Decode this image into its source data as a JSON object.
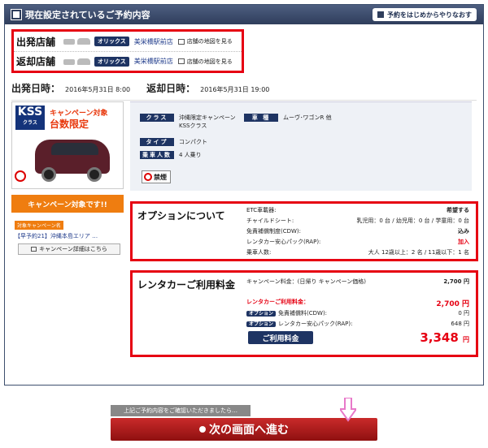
{
  "header": {
    "title": "現在設定されているご予約内容",
    "restart": "予約をはじめからやりなおす"
  },
  "stores": [
    {
      "label": "出発店舗",
      "brand": "オリックス",
      "name": "美栄橋駅前店",
      "map": "店舗の地図を見る"
    },
    {
      "label": "返却店舗",
      "brand": "オリックス",
      "name": "美栄橋駅前店",
      "map": "店舗の地図を見る"
    }
  ],
  "dates": {
    "depart_label": "出発日時：",
    "depart": "2016年5月31日 8:00",
    "return_label": "返却日時：",
    "return": "2016年5月31日 19:00"
  },
  "car": {
    "class_badge_top": "KSS",
    "class_badge_bottom": "クラス",
    "campaign_line1": "キャンペーン対象",
    "campaign_line2": "台数限定",
    "campaign_button": "キャンペーン対象です!!",
    "campaign_tag": "対象キャンペーン名",
    "campaign_name": "【早予約21】沖縄本島エリア …",
    "campaign_detail": "キャンペーン詳細はこちら"
  },
  "specs": {
    "class_label": "クラス",
    "class_value": "沖縄限定キャンペーン\nKSSクラス",
    "model_label": "車 種",
    "model_value": "ムーヴ･ワゴンR 他",
    "type_label": "タイプ",
    "type_value": "コンパクト",
    "seats_label": "乗車人数",
    "seats_value": "4 人乗り",
    "nosmoke": "禁煙"
  },
  "options": {
    "title": "オプションについて",
    "items": [
      {
        "label": "ETC車載器:",
        "value": "希望する"
      },
      {
        "label": "チャイルドシート:",
        "value": "乳児用：0 台 / 幼児用：0 台 / 学童用：0 台"
      },
      {
        "label": "免責補償制度(CDW):",
        "value": "込み"
      },
      {
        "label": "レンタカー安心パック(RAP):",
        "value": "加入"
      },
      {
        "label": "乗車人数:",
        "value": "大人 12歳以上：2 名 / 11歳以下：1 名"
      }
    ]
  },
  "rental": {
    "title": "レンタカーご利用料金",
    "campaign_label": "キャンペーン料金：(日帰り キャンペーン価格)",
    "campaign_value": "2,700 円",
    "fee_label": "レンタカーご利用料金：",
    "fee_value": "2,700 円",
    "opt_tag": "オプション",
    "cdw_label": "免責補償料(CDW):",
    "cdw_value": "0 円",
    "rap_label": "レンタカー安心パック(RAP):",
    "rap_value": "648 円",
    "total_label": "ご利用料金",
    "total_value": "3,348",
    "total_unit": "円"
  },
  "footer": {
    "confirm": "上記ご予約内容をご確認いただきましたら…",
    "next": "次の画面へ進む"
  }
}
